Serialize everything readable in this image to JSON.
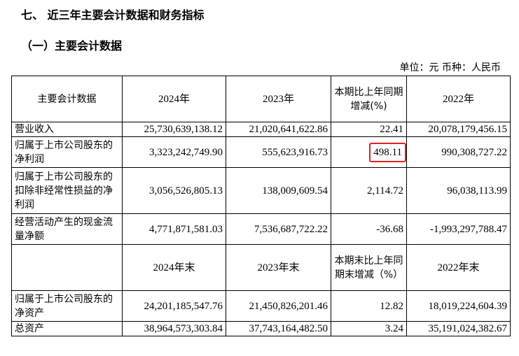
{
  "section_title": "七、 近三年主要会计数据和财务指标",
  "subsection_title": "（一）主要会计数据",
  "unit_note": "单位：元  币种：人民币",
  "colors": {
    "highlight_border": "#e5211f"
  },
  "table": {
    "header1": {
      "col0": "主要会计数据",
      "col1": "2024年",
      "col2": "2023年",
      "col3": "本期比上年同期增减(%)",
      "col4": "2022年"
    },
    "rows1": [
      {
        "label": "营业收入",
        "v2024": "25,730,639,138.12",
        "v2023": "21,020,641,622.86",
        "change": "22.41",
        "v2022": "20,078,179,456.15"
      },
      {
        "label": "归属于上市公司股东的净利润",
        "v2024": "3,323,242,749.90",
        "v2023": "555,623,916.73",
        "change": "498.11",
        "v2022": "990,308,727.22"
      },
      {
        "label": "归属于上市公司股东的扣除非经常性损益的净利润",
        "v2024": "3,056,526,805.13",
        "v2023": "138,009,609.54",
        "change": "2,114.72",
        "v2022": "96,038,113.99"
      },
      {
        "label": "经营活动产生的现金流量净额",
        "v2024": "4,771,871,581.03",
        "v2023": "7,536,687,722.22",
        "change": "-36.68",
        "v2022": "-1,993,297,788.47"
      }
    ],
    "header2": {
      "col0": "",
      "col1": "2024年末",
      "col2": "2023年末",
      "col3": "本期末比上年同期末增减（%）",
      "col4": "2022年末"
    },
    "rows2": [
      {
        "label": "归属于上市公司股东的净资产",
        "v2024": "24,201,185,547.76",
        "v2023": "21,450,826,201.46",
        "change": "12.82",
        "v2022": "18,019,224,604.39"
      },
      {
        "label": "总资产",
        "v2024": "38,964,573,303.84",
        "v2023": "37,743,164,482.50",
        "change": "3.24",
        "v2022": "35,191,024,382.67"
      }
    ]
  }
}
